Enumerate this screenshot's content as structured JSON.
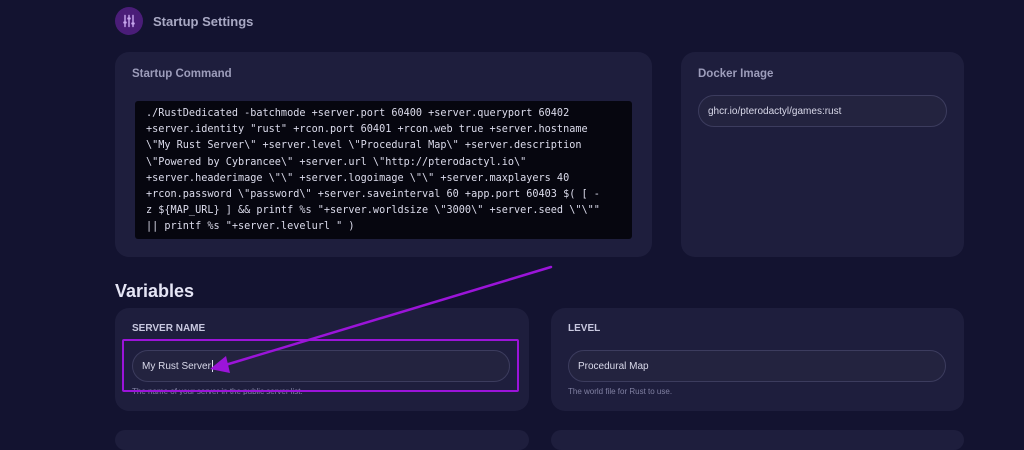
{
  "header": {
    "title": "Startup Settings",
    "icon": "sliders-icon"
  },
  "startup_command": {
    "label": "Startup Command",
    "lines": [
      "./RustDedicated -batchmode +server.port 60400 +server.queryport 60402",
      "+server.identity \"rust\" +rcon.port 60401 +rcon.web true +server.hostname",
      "\\\"My Rust Server\\\" +server.level \\\"Procedural Map\\\" +server.description",
      "\\\"Powered by Cybrancee\\\" +server.url \\\"http://pterodactyl.io\\\"",
      "+server.headerimage \\\"\\\" +server.logoimage \\\"\\\" +server.maxplayers 40",
      "+rcon.password \\\"password\\\" +server.saveinterval 60 +app.port 60403 $( [ -",
      "z ${MAP_URL} ] && printf %s \"+server.worldsize \\\"3000\\\" +server.seed \\\"\\\"\"",
      "|| printf %s \"+server.levelurl \" )"
    ]
  },
  "docker_image": {
    "label": "Docker Image",
    "value": "ghcr.io/pterodactyl/games:rust"
  },
  "variables": {
    "title": "Variables",
    "server_name": {
      "label": "SERVER NAME",
      "value": "My Rust Server",
      "help": "The name of your server in the public server list."
    },
    "level": {
      "label": "LEVEL",
      "value": "Procedural Map",
      "help": "The world file for Rust to use."
    }
  },
  "colors": {
    "background": "#131330",
    "card": "#1e1e3d",
    "annotation": "#9b14d9"
  }
}
